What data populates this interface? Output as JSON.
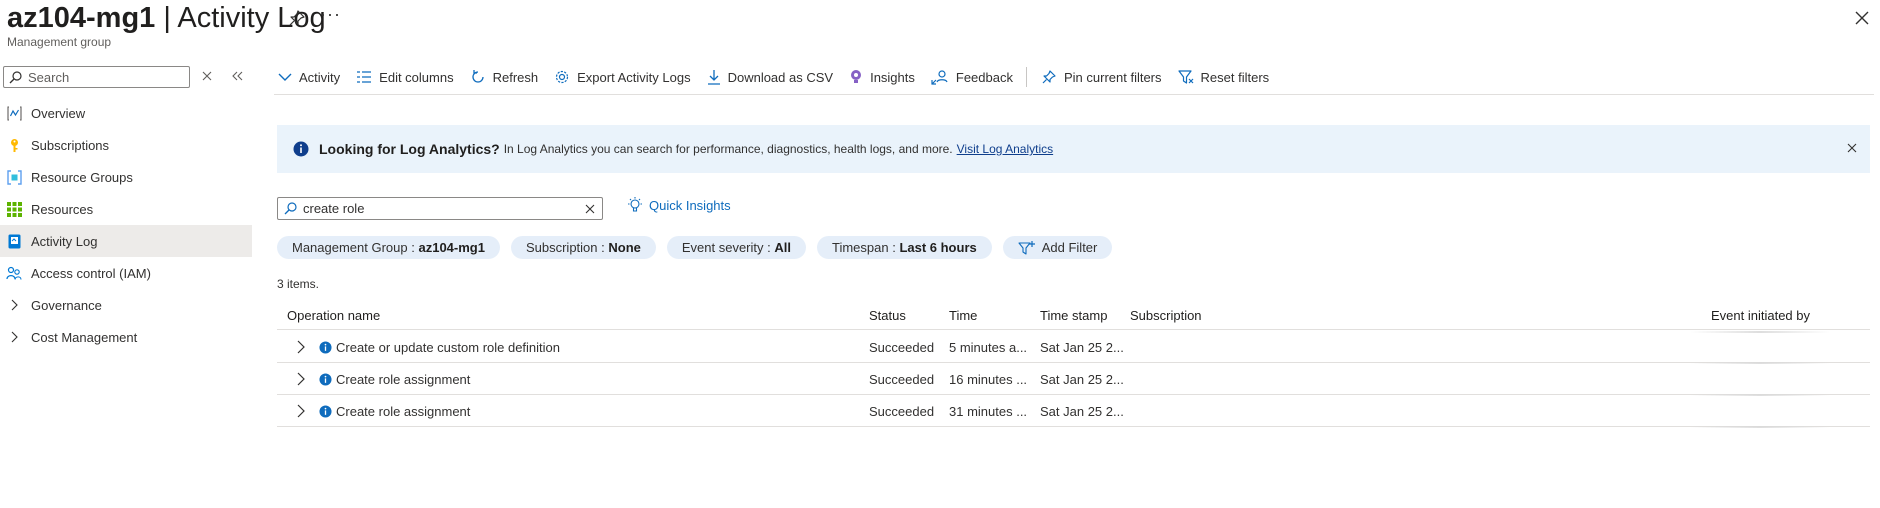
{
  "header": {
    "title_bold": "az104-mg1",
    "title_rest": " | Activity Log",
    "subtitle": "Management group",
    "more": "···"
  },
  "sidebar": {
    "search_placeholder": "Search",
    "items": [
      {
        "label": "Overview",
        "icon": "overview-icon"
      },
      {
        "label": "Subscriptions",
        "icon": "key-icon"
      },
      {
        "label": "Resource Groups",
        "icon": "resource-group-icon"
      },
      {
        "label": "Resources",
        "icon": "grid-icon"
      },
      {
        "label": "Activity Log",
        "icon": "activity-log-icon",
        "active": true
      },
      {
        "label": "Access control (IAM)",
        "icon": "people-icon"
      },
      {
        "label": "Governance",
        "icon": "chevron-right-icon"
      },
      {
        "label": "Cost Management",
        "icon": "chevron-right-icon"
      }
    ]
  },
  "toolbar": {
    "activity": "Activity",
    "edit_columns": "Edit columns",
    "refresh": "Refresh",
    "export": "Export Activity Logs",
    "download": "Download as CSV",
    "insights": "Insights",
    "feedback": "Feedback",
    "pin_filters": "Pin current filters",
    "reset_filters": "Reset filters"
  },
  "banner": {
    "title": "Looking for Log Analytics?",
    "text": "In Log Analytics you can search for performance, diagnostics, health logs, and more.",
    "link": "Visit Log Analytics"
  },
  "filter": {
    "search_value": "create role",
    "quick_insights": "Quick Insights",
    "pills": [
      {
        "label": "Management Group : ",
        "value": "az104-mg1"
      },
      {
        "label": "Subscription : ",
        "value": "None"
      },
      {
        "label": "Event severity : ",
        "value": "All"
      },
      {
        "label": "Timespan : ",
        "value": "Last 6 hours"
      }
    ],
    "add_filter": "Add Filter"
  },
  "table": {
    "count": "3 items.",
    "columns": {
      "operation": "Operation name",
      "status": "Status",
      "time": "Time",
      "timestamp": "Time stamp",
      "subscription": "Subscription",
      "initiated_by": "Event initiated by"
    },
    "rows": [
      {
        "operation": "Create or update custom role definition",
        "status": "Succeeded",
        "time": "5 minutes a...",
        "timestamp": "Sat Jan 25 2..."
      },
      {
        "operation": "Create role assignment",
        "status": "Succeeded",
        "time": "16 minutes ...",
        "timestamp": "Sat Jan 25 2..."
      },
      {
        "operation": "Create role assignment",
        "status": "Succeeded",
        "time": "31 minutes ...",
        "timestamp": "Sat Jan 25 2..."
      }
    ]
  },
  "colors": {
    "accent": "#0f6cbd",
    "banner_bg": "#eaf3fb",
    "pill_bg": "#e5eef9",
    "active_nav": "#edebe9"
  }
}
